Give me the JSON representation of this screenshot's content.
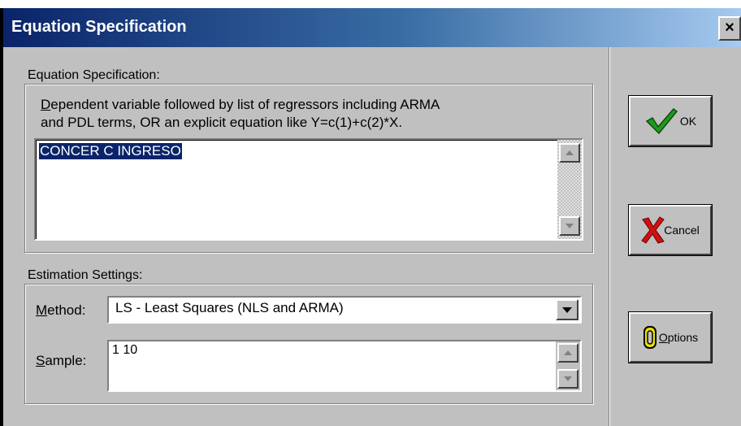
{
  "window": {
    "title": "Equation Specification",
    "close_glyph": "×"
  },
  "equation": {
    "group_label": "Equation Specification:",
    "instructions_line1_first": "D",
    "instructions_line1_rest": "ependent variable followed by list of regressors including ARMA",
    "instructions_line2": "and PDL terms, OR an explicit equation like Y=c(1)+c(2)*X.",
    "value": "CONCER C INGRESO"
  },
  "estimation": {
    "group_label": "Estimation Settings:",
    "method_label_first": "M",
    "method_label_rest": "ethod:",
    "method_value": "LS - Least Squares (NLS and ARMA)",
    "sample_label_first": "S",
    "sample_label_rest": "ample:",
    "sample_value": "1 10"
  },
  "buttons": {
    "ok": "OK",
    "cancel": "Cancel",
    "options_first": "O",
    "options_rest": "ptions"
  },
  "icons": {
    "ok": "checkmark-icon",
    "cancel": "x-mark-icon",
    "options": "options-icon",
    "scroll_up": "arrow-up-icon",
    "scroll_down": "arrow-down-icon",
    "dropdown": "chevron-down-icon"
  },
  "colors": {
    "title_start": "#0a246a",
    "selection": "#0a246a",
    "check_green": "#1f9a1f",
    "x_red": "#d01010",
    "options_yellow": "#e8e000"
  }
}
